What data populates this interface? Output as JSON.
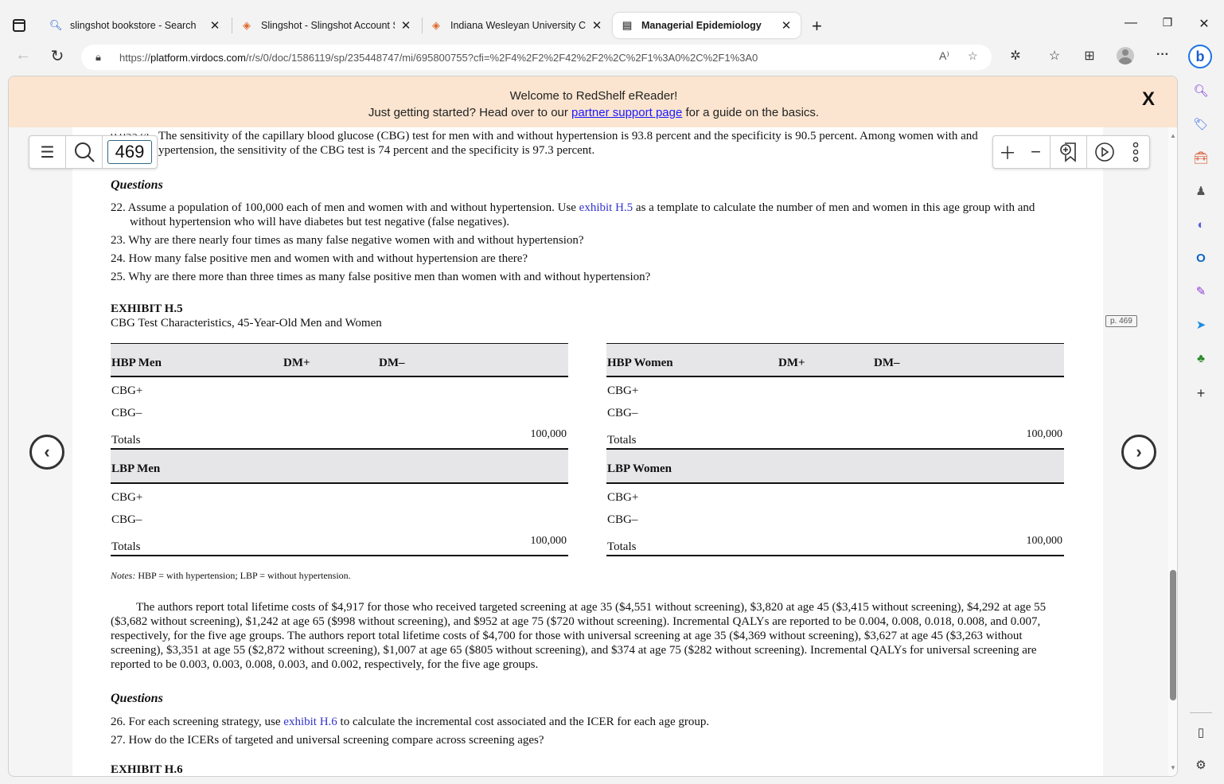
{
  "browser": {
    "tabs": [
      {
        "label": "slingshot bookstore - Search",
        "icon": "search-icon",
        "active": false
      },
      {
        "label": "Slingshot - Slingshot Account Stu",
        "icon": "slingshot-icon",
        "active": false
      },
      {
        "label": "Indiana Wesleyan University Cam",
        "icon": "slingshot-icon",
        "active": false
      },
      {
        "label": "Managerial Epidemiology",
        "icon": "reader-icon",
        "active": true
      }
    ],
    "close_glyph": "✕",
    "new_tab_glyph": "+",
    "window_controls": {
      "minimize": "—",
      "restore": "❐",
      "close": "✕"
    },
    "url": {
      "domain_prefix": "https://",
      "domain": "platform.virdocs.com",
      "path": "/r/s/0/doc/1586119/sp/235448747/mi/695800755?cfi=%2F4%2F2%2F42%2F2%2C%2F1%3A0%2C%2F1%3A0"
    }
  },
  "banner": {
    "line1": "Welcome to RedShelf eReader!",
    "line2_before": "Just getting started? Head over to our ",
    "line2_link": "partner support page",
    "line2_after": " for a guide on the basics.",
    "close_glyph": "X"
  },
  "reader": {
    "page_number": "469",
    "page_badge": "p. 469",
    "prev_glyph": "‹",
    "next_glyph": "›"
  },
  "document": {
    "cut_prefix": "0.05524",
    "top_para_line1": "The sensitivity of the capillary blood glucose (CBG) test for men with and without hypertension is 93.8 percent and the specificity is 90.5 percent. Among women with and",
    "top_para_line2": "ypertension, the sensitivity of the CBG test is 74 percent and the specificity is 97.3 percent.",
    "questions_heading_1": "Questions",
    "questions_1": [
      {
        "before": "22. Assume a population of 100,000 each of men and women with and without hypertension. Use ",
        "link": "exhibit H.5",
        "after": " as a template to calculate the number of men and women in this age group with and without hypertension who will have diabetes but test negative (false negatives)."
      },
      {
        "before": "23. Why are there nearly four times as many false negative women with and without hypertension?",
        "link": "",
        "after": ""
      },
      {
        "before": "24. How many false positive men and women with and without hypertension are there?",
        "link": "",
        "after": ""
      },
      {
        "before": "25. Why are there more than three times as many false positive men than women with and without hypertension?",
        "link": "",
        "after": ""
      }
    ],
    "exhibit_h5": {
      "title": "EXHIBIT H.5",
      "subtitle": "CBG Test Characteristics, 45-Year-Old Men and Women",
      "col_dm_plus": "DM+",
      "col_dm_minus": "DM–",
      "row_cbg_plus": "CBG+",
      "row_cbg_minus": "CBG–",
      "row_totals": "Totals",
      "tables": [
        {
          "group": "HBP Men",
          "total": "100,000"
        },
        {
          "group": "HBP Women",
          "total": "100,000"
        },
        {
          "group": "LBP Men",
          "total": "100,000"
        },
        {
          "group": "LBP Women",
          "total": "100,000"
        }
      ],
      "notes_label": "Notes:",
      "notes_text": " HBP = with hypertension; LBP = without hypertension."
    },
    "body_para": "The authors report total lifetime costs of $4,917 for those who received targeted screening at age 35 ($4,551 without screening), $3,820 at age 45 ($3,415 without screening), $4,292 at age 55 ($3,682 without screening), $1,242 at age 65 ($998 without screening), and $952 at age 75 ($720 without screening). Incremental QALYs are reported to be 0.004, 0.008, 0.018, 0.008, and 0.007, respectively, for the five age groups. The authors report total lifetime costs of $4,700 for those with universal screening at age 35 ($4,369 without screening), $3,627 at age 45 ($3,263 without screening), $3,351 at age 55 ($2,872 without screening), $1,007 at age 65 ($805 without screening), and $374 at age 75 ($282 without screening). Incremental QALYs for universal screening are reported to be 0.003, 0.003, 0.008, 0.003, and 0.002, respectively, for the five age groups.",
    "questions_heading_2": "Questions",
    "questions_2": [
      {
        "before": "26. For each screening strategy, use ",
        "link": "exhibit H.6",
        "after": " to calculate the incremental cost associated and the ICER for each age group."
      },
      {
        "before": "27. How do the ICERs of targeted and universal screening compare across screening ages?",
        "link": "",
        "after": ""
      }
    ],
    "next_exhibit": "EXHIBIT H.6"
  },
  "colors": {
    "banner_bg": "#fbe5d0",
    "link": "#3333cc",
    "table_header_bg": "#e6e6e8"
  }
}
